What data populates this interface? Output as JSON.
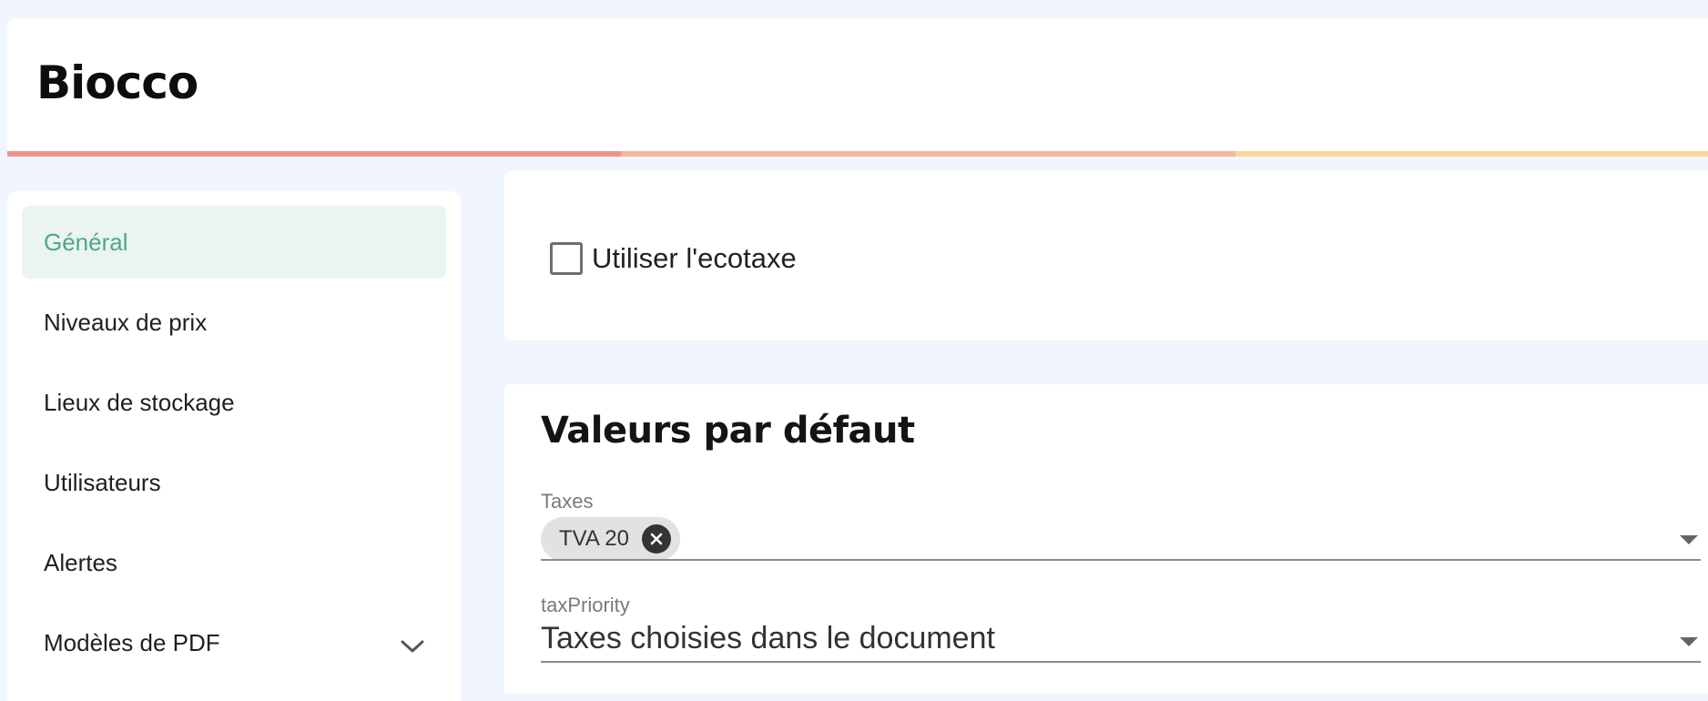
{
  "header": {
    "title": "Biocco",
    "accent_colors": [
      "#ec968b",
      "#f5b59f",
      "#f9d79b"
    ]
  },
  "sidebar": {
    "items": [
      {
        "label": "Général",
        "active": true
      },
      {
        "label": "Niveaux de prix"
      },
      {
        "label": "Lieux de stockage"
      },
      {
        "label": "Utilisateurs"
      },
      {
        "label": "Alertes"
      },
      {
        "label": "Modèles de PDF",
        "icon": "chevron-down-icon"
      }
    ]
  },
  "ecotaxe": {
    "label": "Utiliser l'ecotaxe",
    "checked": false
  },
  "defaults": {
    "title": "Valeurs par défaut",
    "taxes": {
      "label": "Taxes",
      "chips": [
        "TVA 20"
      ]
    },
    "tax_priority": {
      "label": "taxPriority",
      "value": "Taxes choisies dans le document"
    }
  },
  "colors": {
    "active_bg": "#eaf4f2",
    "active_text": "#4fa68b",
    "page_bg": "#f1f5fd"
  }
}
